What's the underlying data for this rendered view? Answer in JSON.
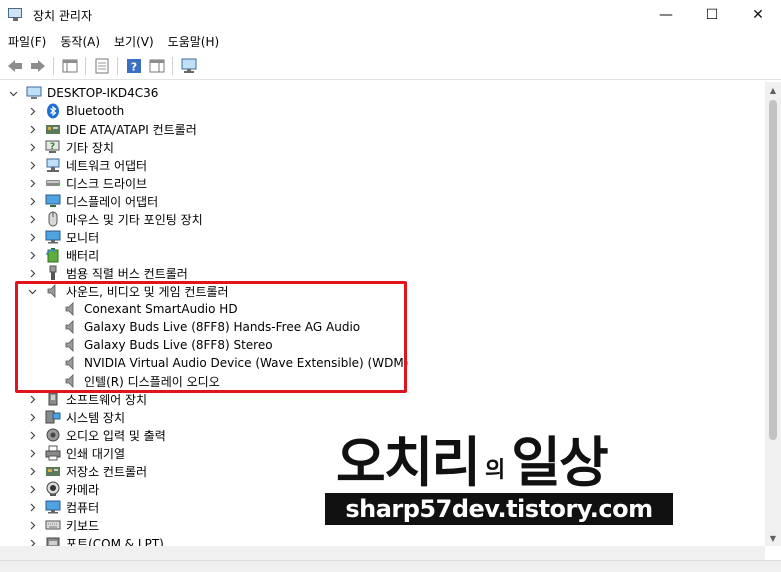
{
  "window": {
    "title": "장치 관리자",
    "minimize_glyph": "—",
    "maximize_glyph": "☐",
    "close_glyph": "✕"
  },
  "menu": [
    "파일(F)",
    "동작(A)",
    "보기(V)",
    "도움말(H)"
  ],
  "toolbar": [
    "back-arrow-icon",
    "forward-arrow-icon",
    "show-hide-tree-icon",
    "properties-icon",
    "help-icon",
    "action-pane-icon",
    "monitor-icon"
  ],
  "tree": {
    "root": {
      "label": "DESKTOP-IKD4C36",
      "icon": "computer-icon",
      "expanded": true
    },
    "categories": [
      {
        "label": "Bluetooth",
        "icon": "bluetooth-icon",
        "expanded": false
      },
      {
        "label": "IDE ATA/ATAPI 컨트롤러",
        "icon": "ide-controller-icon",
        "expanded": false
      },
      {
        "label": "기타 장치",
        "icon": "unknown-device-icon",
        "expanded": false
      },
      {
        "label": "네트워크 어댑터",
        "icon": "network-adapter-icon",
        "expanded": false
      },
      {
        "label": "디스크 드라이브",
        "icon": "disk-drive-icon",
        "expanded": false
      },
      {
        "label": "디스플레이 어댑터",
        "icon": "display-adapter-icon",
        "expanded": false
      },
      {
        "label": "마우스 및 기타 포인팅 장치",
        "icon": "mouse-icon",
        "expanded": false
      },
      {
        "label": "모니터",
        "icon": "monitor-icon",
        "expanded": false
      },
      {
        "label": "배터리",
        "icon": "battery-icon",
        "expanded": false
      },
      {
        "label": "범용 직렬 버스 컨트롤러",
        "icon": "usb-icon",
        "expanded": false
      },
      {
        "label": "사운드, 비디오 및 게임 컨트롤러",
        "icon": "speaker-icon",
        "expanded": true,
        "children": [
          "Conexant SmartAudio HD",
          "Galaxy Buds Live (8FF8) Hands-Free AG Audio",
          "Galaxy Buds Live (8FF8) Stereo",
          "NVIDIA Virtual Audio Device (Wave Extensible) (WDM)",
          "인텔(R) 디스플레이 오디오"
        ]
      },
      {
        "label": "소프트웨어 장치",
        "icon": "software-device-icon",
        "expanded": false
      },
      {
        "label": "시스템 장치",
        "icon": "system-device-icon",
        "expanded": false
      },
      {
        "label": "오디오 입력 및 출력",
        "icon": "audio-io-icon",
        "expanded": false
      },
      {
        "label": "인쇄 대기열",
        "icon": "printer-icon",
        "expanded": false
      },
      {
        "label": "저장소 컨트롤러",
        "icon": "storage-controller-icon",
        "expanded": false
      },
      {
        "label": "카메라",
        "icon": "camera-icon",
        "expanded": false
      },
      {
        "label": "컴퓨터",
        "icon": "computer-icon",
        "expanded": false
      },
      {
        "label": "키보드",
        "icon": "keyboard-icon",
        "expanded": false
      },
      {
        "label": "포트(COM & LPT)",
        "icon": "port-icon",
        "expanded": false
      }
    ]
  },
  "watermark": {
    "title_a": "오치리",
    "title_mid": "의",
    "title_b": "일상",
    "url": "sharp57dev.tistory.com"
  },
  "colors": {
    "highlight": "#e1141d",
    "selection": "#cce8ff"
  }
}
